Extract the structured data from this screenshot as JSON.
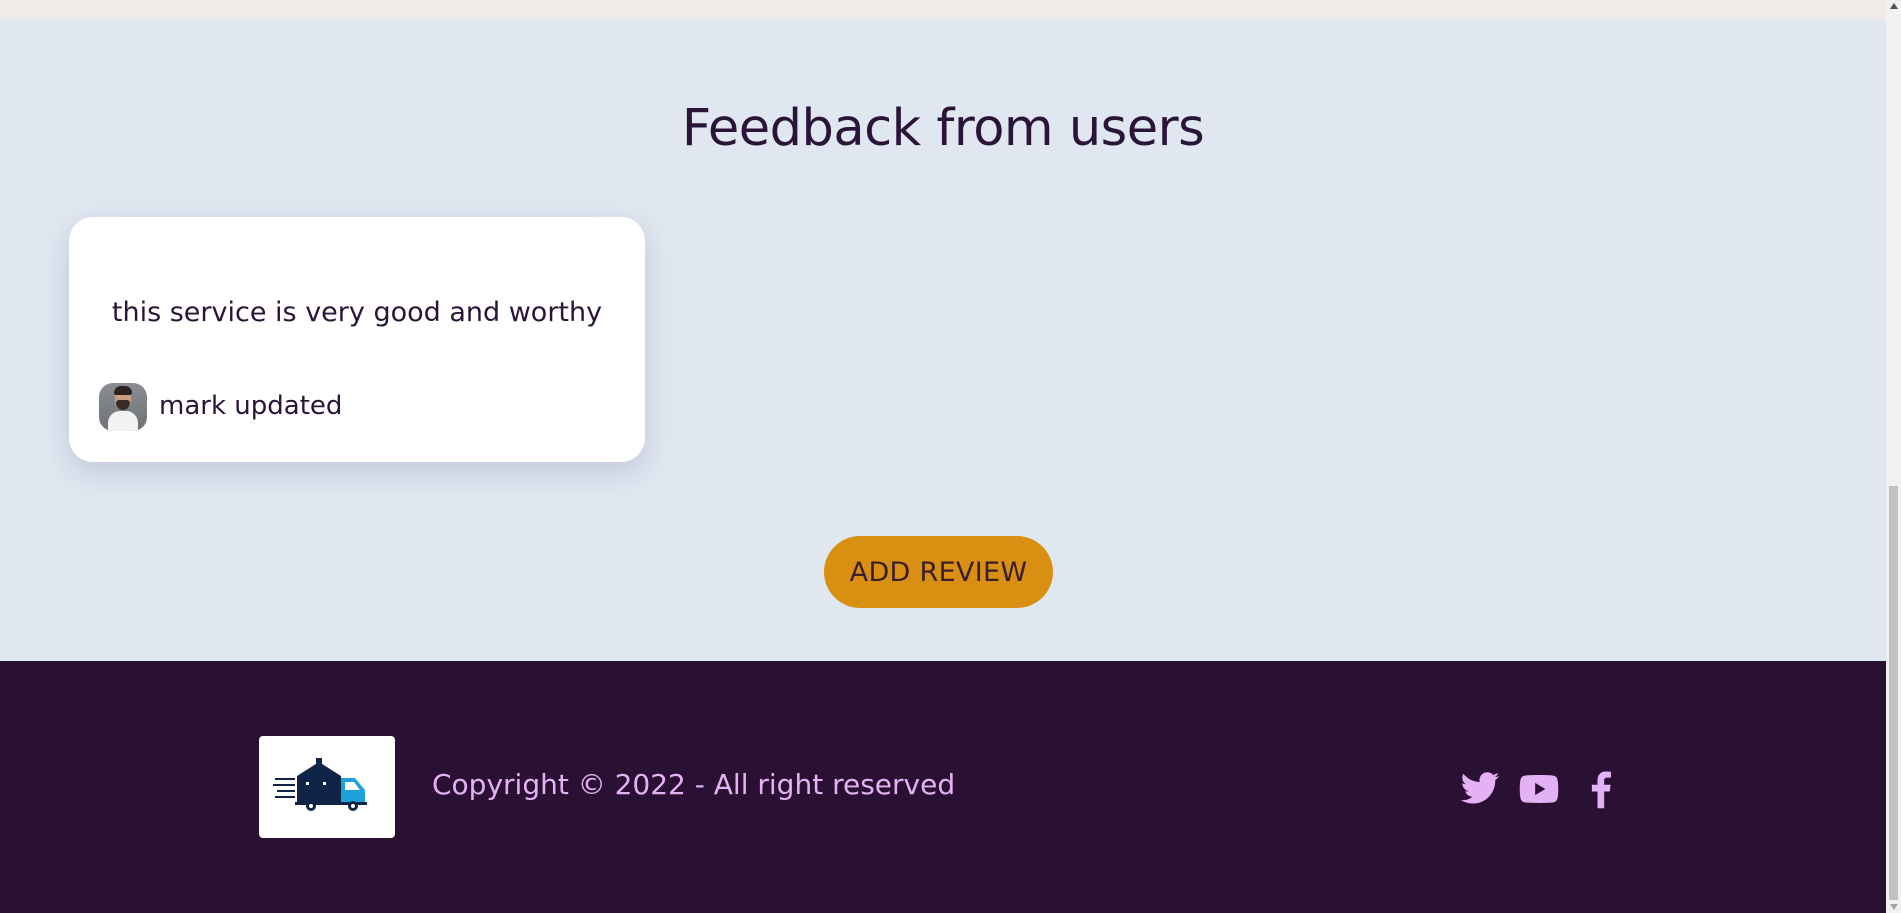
{
  "feedback": {
    "title": "Feedback from users",
    "reviews": [
      {
        "text": "this service is very good and worthy",
        "name": "mark updated"
      }
    ],
    "add_review_label": "ADD REVIEW"
  },
  "footer": {
    "copyright": "Copyright © 2022 - All right reserved",
    "social": [
      "twitter-icon",
      "youtube-icon",
      "facebook-icon"
    ]
  },
  "colors": {
    "section_bg": "#e0e7f1",
    "footer_bg": "#2a1134",
    "accent": "#d98f12",
    "footer_text": "#e4b1f4",
    "title_text": "#2a1538"
  }
}
